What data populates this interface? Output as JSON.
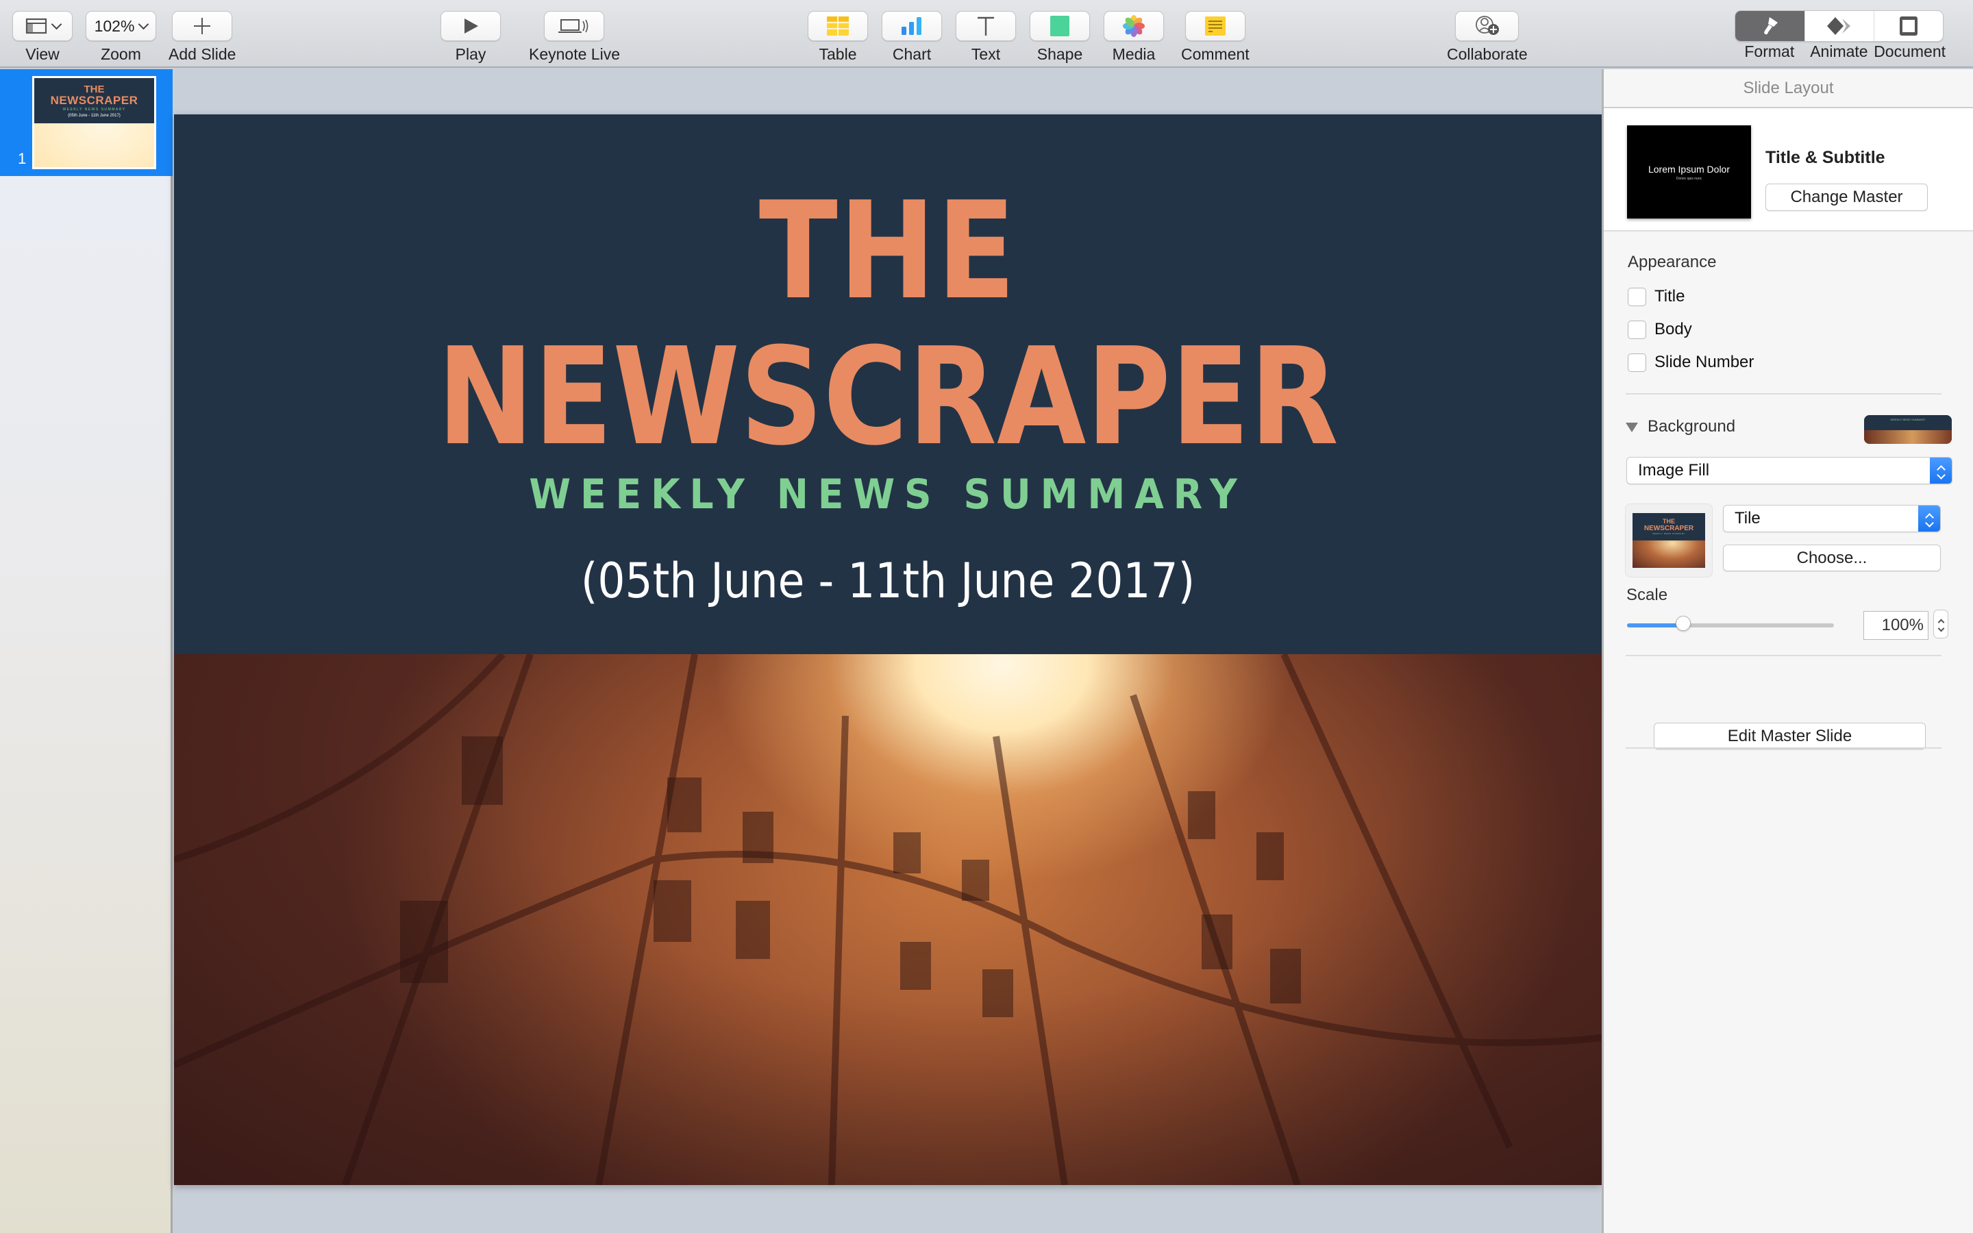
{
  "toolbar": {
    "view": {
      "label": "View",
      "icon": "sidebar-layout-icon"
    },
    "zoom": {
      "label": "Zoom",
      "value": "102%"
    },
    "add_slide": {
      "label": "Add Slide",
      "icon": "plus-icon"
    },
    "play": {
      "label": "Play",
      "icon": "play-icon"
    },
    "keynote_live": {
      "label": "Keynote Live",
      "icon": "laptop-broadcast-icon"
    },
    "insert": [
      {
        "label": "Table",
        "icon": "table-icon"
      },
      {
        "label": "Chart",
        "icon": "chart-icon"
      },
      {
        "label": "Text",
        "icon": "text-icon"
      },
      {
        "label": "Shape",
        "icon": "shape-icon"
      },
      {
        "label": "Media",
        "icon": "photos-icon"
      },
      {
        "label": "Comment",
        "icon": "comment-icon"
      }
    ],
    "collaborate": {
      "label": "Collaborate",
      "icon": "add-person-icon"
    },
    "inspector_tabs": [
      {
        "label": "Format",
        "icon": "paintbrush-icon",
        "active": true
      },
      {
        "label": "Animate",
        "icon": "diamond-icon",
        "active": false
      },
      {
        "label": "Document",
        "icon": "document-icon",
        "active": false
      }
    ]
  },
  "navigator": {
    "slides": [
      {
        "number": "1",
        "selected": true,
        "thumb": {
          "line1": "THE",
          "line2": "NEWSCRAPER",
          "line3": "WEEKLY NEWS SUMMARY",
          "line4": "(05th June - 11th June 2017)"
        }
      }
    ]
  },
  "slide": {
    "title_line1": "THE",
    "title_line2": "NEWSCRAPER",
    "subtitle": "WEEKLY NEWS SUMMARY",
    "dates": "(05th June - 11th June 2017)",
    "colors": {
      "background": "#233346",
      "title": "#e88b62",
      "subtitle": "#7fcf92",
      "dates": "#ffffff"
    }
  },
  "inspector": {
    "header": "Slide Layout",
    "layout": {
      "thumb_title": "Lorem Ipsum Dolor",
      "thumb_subtitle": "Donec quis nunc",
      "name": "Title & Subtitle",
      "change_master": "Change Master"
    },
    "appearance": {
      "label": "Appearance",
      "options": [
        {
          "label": "Title",
          "checked": false
        },
        {
          "label": "Body",
          "checked": false
        },
        {
          "label": "Slide Number",
          "checked": false
        }
      ]
    },
    "background": {
      "label": "Background",
      "fill_type": "Image Fill",
      "preview_text": "WEEKLY NEWS SUMMARY",
      "image_thumb": {
        "line1": "THE",
        "line2": "NEWSCRAPER",
        "line3": "WEEKLY NEWS SUMMARY"
      },
      "image_mode": "Tile",
      "choose": "Choose...",
      "scale_label": "Scale",
      "scale_value": "100%",
      "scale_slider_fraction": 0.27
    },
    "edit_master": "Edit Master Slide"
  }
}
